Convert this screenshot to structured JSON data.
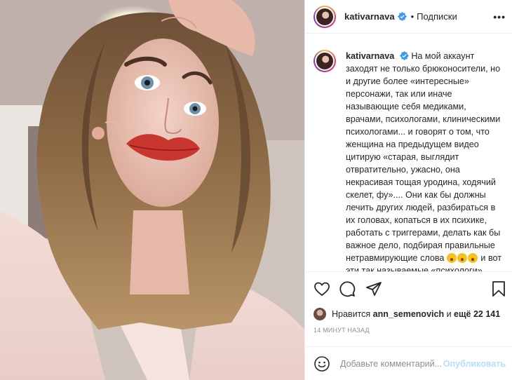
{
  "post": {
    "username": "kativarnava",
    "dot": "•",
    "follow_label": "Подписки",
    "more_label": "•••"
  },
  "caption": {
    "username": "kativarnava",
    "part1": "На мой аккаунт заходят не только брюконосители, но и другие более «интересные» персонажи, так или иначе называющие себя медиками, врачами, психологами, клиническими психологами... и говорят о том, что женщина на предыдущем видео цитирую «старая, выглядит отвратительно, ужасно, она некрасивая тощая уродина, ходячий скелет, фу».... Они как бы должны лечить других людей, разбираться в их головах, копаться в их психике, работать с триггерами, делать как бы важное дело, подбирая правильные нетравмирующие слова",
    "part2": " и вот эти так называемые «психологи» наравне со «счастливыми мамочками ангелочков» заходят ко мне и пишут в"
  },
  "likes": {
    "prefix": "Нравится",
    "user": "ann_semenovich",
    "conj": "и",
    "count": "ещё 22 141"
  },
  "timestamp": "14 МИНУТ НАЗАД",
  "comment": {
    "placeholder": "Добавьте комментарий...",
    "post_label": "Опубликовать"
  },
  "colors": {
    "verified": "#3897f0",
    "post_disabled": "#b2dffc",
    "muted": "#8e8e8e"
  },
  "icons": [
    "heart-icon",
    "comment-icon",
    "share-icon",
    "bookmark-icon",
    "smile-icon",
    "verified-icon"
  ]
}
